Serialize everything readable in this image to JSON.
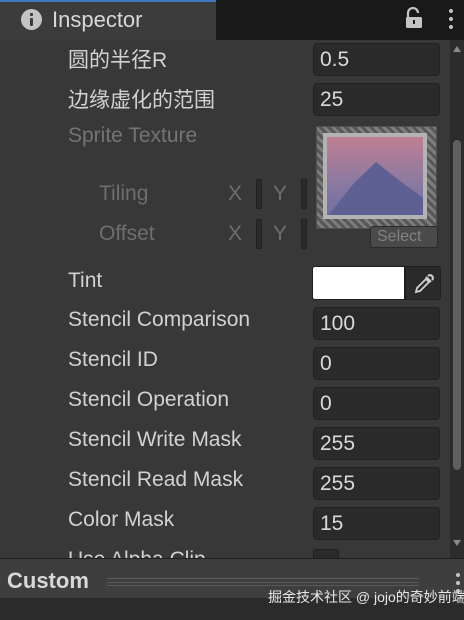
{
  "window": {
    "tab_title": "Inspector",
    "tab_icon": "info-icon",
    "lock_icon": "lock-icon",
    "menu_icon": "menu-dots-icon"
  },
  "properties": [
    {
      "label": "圆的半径R",
      "value": "0.5"
    },
    {
      "label": "边缘虚化的范围",
      "value": "25"
    }
  ],
  "sprite_texture": {
    "label": "Sprite Texture",
    "select_label": "Select",
    "tiling_label": "Tiling",
    "offset_label": "Offset",
    "x_label": "X",
    "y_label": "Y"
  },
  "tint": {
    "label": "Tint",
    "color": "#ffffff",
    "picker_icon": "eyedropper-icon"
  },
  "stencil": [
    {
      "label": "Stencil Comparison",
      "value": "100"
    },
    {
      "label": "Stencil ID",
      "value": "0"
    },
    {
      "label": "Stencil Operation",
      "value": "0"
    },
    {
      "label": "Stencil Write Mask",
      "value": "255"
    },
    {
      "label": "Stencil Read Mask",
      "value": "255"
    },
    {
      "label": "Color Mask",
      "value": "15"
    }
  ],
  "cut_off_label": "Use Alpha Clip",
  "bottom": {
    "title": "Custom",
    "watermark": "掘金技术社区 @ jojo的奇妙前端"
  },
  "colors": {
    "accent": "#3a79bb",
    "panel": "#383838",
    "field": "#2a2a2a"
  }
}
